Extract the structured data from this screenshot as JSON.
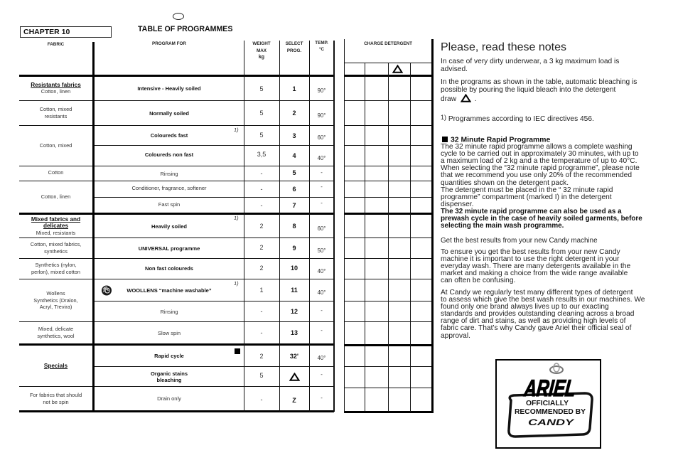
{
  "header": {
    "language_marker_icon": "empty-ellipse",
    "chapter_label": "CHAPTER 10",
    "title": "TABLE OF PROGRAMMES"
  },
  "table": {
    "columns": {
      "fabric": "FABRIC",
      "program": "PROGRAM FOR",
      "weight": [
        "WEIGHT",
        "MAX",
        "kg"
      ],
      "select": [
        "SELECT",
        "PROG."
      ],
      "temp": [
        "TEMP.",
        "°C"
      ],
      "charge_detergent": "CHARGE DETERGENT",
      "charge_compartment_icons": [
        "",
        "",
        "bleach-triangle-icon",
        ""
      ]
    },
    "fabric_groups": [
      {
        "title": [
          "Resistants fabrics"
        ],
        "lines": [
          "Cotton, linen"
        ]
      },
      {
        "lines": [
          "Cotton, mixed",
          "resistants"
        ]
      },
      {
        "lines": [
          "Cotton, mixed"
        ]
      },
      {
        "lines": [
          "Cotton"
        ]
      },
      {
        "lines": [
          "Cotton, linen"
        ]
      },
      {
        "title": [
          "Mixed fabrics and",
          "delicates"
        ],
        "lines": [
          "Mixed, resistants"
        ]
      },
      {
        "lines": [
          "Cotton, mixed fabrics,",
          "synthetics"
        ]
      },
      {
        "lines": [
          "Synthetics (nylon,",
          "perlon), mixed cotton"
        ]
      },
      {
        "lines": [
          "Wollens",
          "Synthetics (Dralon,",
          "Acryl, Trevira)"
        ]
      },
      {
        "lines": [
          "Mixed, delicate",
          "synthetics, wool"
        ]
      },
      {
        "title": [
          "Specials"
        ]
      },
      {
        "lines": [
          "For fabrics that should",
          "not be spin"
        ]
      }
    ],
    "rows": [
      {
        "program": [
          "Intensive - Heavily soiled"
        ],
        "weight": "5",
        "select": "1",
        "temp": "90°"
      },
      {
        "program": [
          "Normally soiled"
        ],
        "weight": "5",
        "select": "2",
        "temp": "90°"
      },
      {
        "program": [
          "Coloureds fast"
        ],
        "note": "1)",
        "weight": "5",
        "select": "3",
        "temp": "60°"
      },
      {
        "program": [
          "Coloureds non fast"
        ],
        "weight": "3,5",
        "select": "4",
        "temp": "40°"
      },
      {
        "program": [
          "Rinsing"
        ],
        "weight": "-",
        "select": "5",
        "temp": "-"
      },
      {
        "program": [
          "Conditioner, fragrance, softener"
        ],
        "weight": "-",
        "select": "6",
        "temp": "-"
      },
      {
        "program": [
          "Fast spin"
        ],
        "weight": "-",
        "select": "7",
        "temp": "-"
      },
      {
        "program": [
          "Heavily soiled"
        ],
        "note": "1)",
        "weight": "2",
        "select": "8",
        "temp": "60°"
      },
      {
        "program": [
          "UNIVERSAL programme"
        ],
        "weight": "2",
        "select": "9",
        "temp": "50°"
      },
      {
        "program": [
          "Non fast coloureds"
        ],
        "weight": "2",
        "select": "10",
        "temp": "40°"
      },
      {
        "program": [
          "WOOLLENS “machine washable”"
        ],
        "icon": "woolmark-icon",
        "note": "1)",
        "weight": "1",
        "select": "11",
        "temp": "40°"
      },
      {
        "program": [
          "Rinsing"
        ],
        "weight": "-",
        "select": "12",
        "temp": "-"
      },
      {
        "program": [
          "Slow spin"
        ],
        "weight": "-",
        "select": "13",
        "temp": "-"
      },
      {
        "program": [
          "Rapid cycle"
        ],
        "marker_icon": "rapid-programme-square-icon",
        "weight": "2",
        "select": "32'",
        "temp": "40°"
      },
      {
        "program": [
          "Organic stains",
          "bleaching"
        ],
        "weight": "5",
        "select": "",
        "select_icon": "bleach-triangle-icon",
        "temp": "-"
      },
      {
        "program": [
          "Drain only"
        ],
        "weight": "-",
        "select": "Z",
        "temp": "-"
      }
    ]
  },
  "notes": {
    "heading": "Please, read these notes",
    "para1": [
      "In case of very dirty underwear, a 3 kg maximum load is",
      "advised."
    ],
    "para2": [
      "In the programs as shown in the table, automatic bleaching is",
      "possible by pouring the liquid bleach into the detergent",
      "draw"
    ],
    "para2_icon": "bleach-triangle-icon",
    "para2_end": ".",
    "footnote_marker": "1)",
    "footnote": "Programmes according to IEC directives 456."
  },
  "rapid": {
    "title": "32 Minute Rapid Programme",
    "title_icon": "rapid-programme-square-icon",
    "lines": [
      "The 32 minute rapid programme allows a complete washing",
      "cycle to be carried out in approximately 30 minutes, with up to",
      "a maximum load of 2 kg and a the temperature of up to 40°C.",
      "When selecting the “32 minute rapid programme”, please note",
      "that we recommend you use only 20% of the recommended",
      "quantities shown on the detergent pack.",
      "The detergent must be placed in the “ 32 minute rapid",
      "programme” compartment (marked I) in the detergent",
      "dispenser."
    ],
    "bold_lines": [
      "The 32 minute rapid programme can also be used as a",
      "prewash cycle in the case of heavily soiled garments, before",
      "selecting the main wash programme."
    ]
  },
  "candy": {
    "title": "Get the best results from your new Candy machine",
    "para1": [
      "To ensure you get the best results from your new Candy",
      "machine it is important to use the right detergent in your",
      "everyday wash. There are many detergents available in the",
      "market and making a choice from the wide range available",
      "can often be confusing."
    ],
    "para2": [
      "At Candy we regularly test many different types of detergent",
      "to assess which give the best wash results in our machines. We",
      "found only one brand always lives up to our exacting",
      "standards and provides outstanding cleaning across a broad",
      "range of dirt and stains, as well as providing high levels of",
      "fabric care. That’s why Candy gave Ariel their official seal of",
      "approval."
    ]
  },
  "ariel_logo": {
    "brand": "ARIEL",
    "line1": "OFFICIALLY",
    "line2": "RECOMMENDED BY",
    "partner": "CANDY"
  }
}
